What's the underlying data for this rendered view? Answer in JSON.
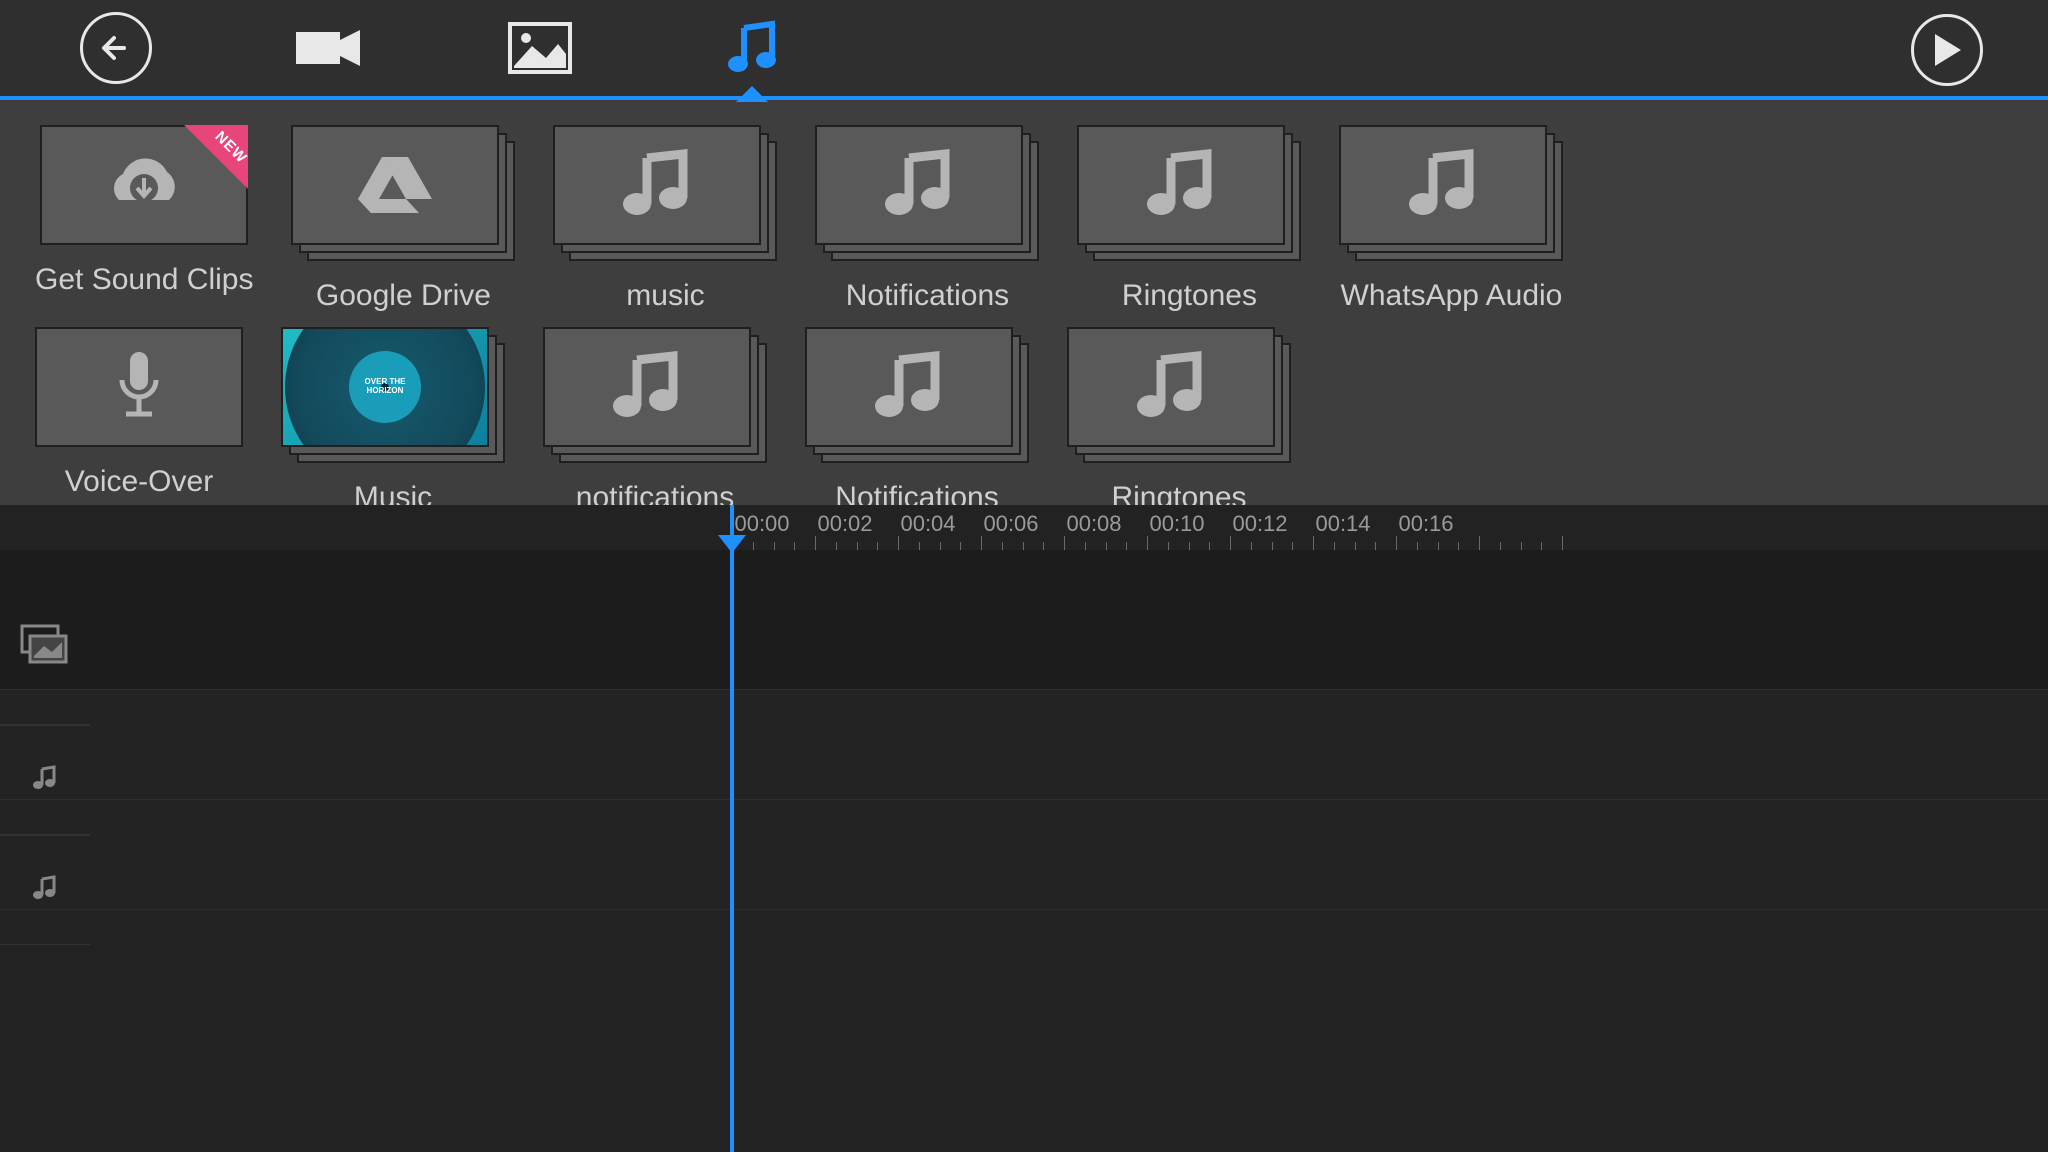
{
  "topbar": {
    "back": "Back",
    "tabs": [
      "video",
      "image",
      "music"
    ],
    "active_tab": "music",
    "play": "Play"
  },
  "sources": {
    "row1": [
      {
        "label": "Get Sound Clips",
        "icon": "cloud-download",
        "badge": "NEW",
        "stacked": false
      },
      {
        "label": "Google Drive",
        "icon": "drive",
        "stacked": true
      },
      {
        "label": "music",
        "icon": "music-note",
        "stacked": true
      },
      {
        "label": "Notifications",
        "icon": "music-note",
        "stacked": true
      },
      {
        "label": "Ringtones",
        "icon": "music-note",
        "stacked": true
      },
      {
        "label": "WhatsApp Audio",
        "icon": "music-note",
        "stacked": true
      }
    ],
    "row2": [
      {
        "label": "Voice-Over",
        "icon": "microphone",
        "stacked": false
      },
      {
        "label": "Music",
        "icon": "album",
        "album_text": "OVER THE HORIZON",
        "stacked": true
      },
      {
        "label": "notifications",
        "icon": "music-note",
        "stacked": true
      },
      {
        "label": "Notifications",
        "icon": "music-note",
        "stacked": true
      },
      {
        "label": "Ringtones",
        "icon": "music-note",
        "stacked": true
      }
    ]
  },
  "timeline": {
    "labels": [
      "00:00",
      "00:02",
      "00:04",
      "00:06",
      "00:08",
      "00:10",
      "00:12",
      "00:14",
      "00:16"
    ],
    "playhead_time": "00:00",
    "tracks": [
      "media",
      "audio1",
      "audio2"
    ]
  },
  "colors": {
    "accent": "#1e90ff",
    "badge": "#e8457a"
  }
}
